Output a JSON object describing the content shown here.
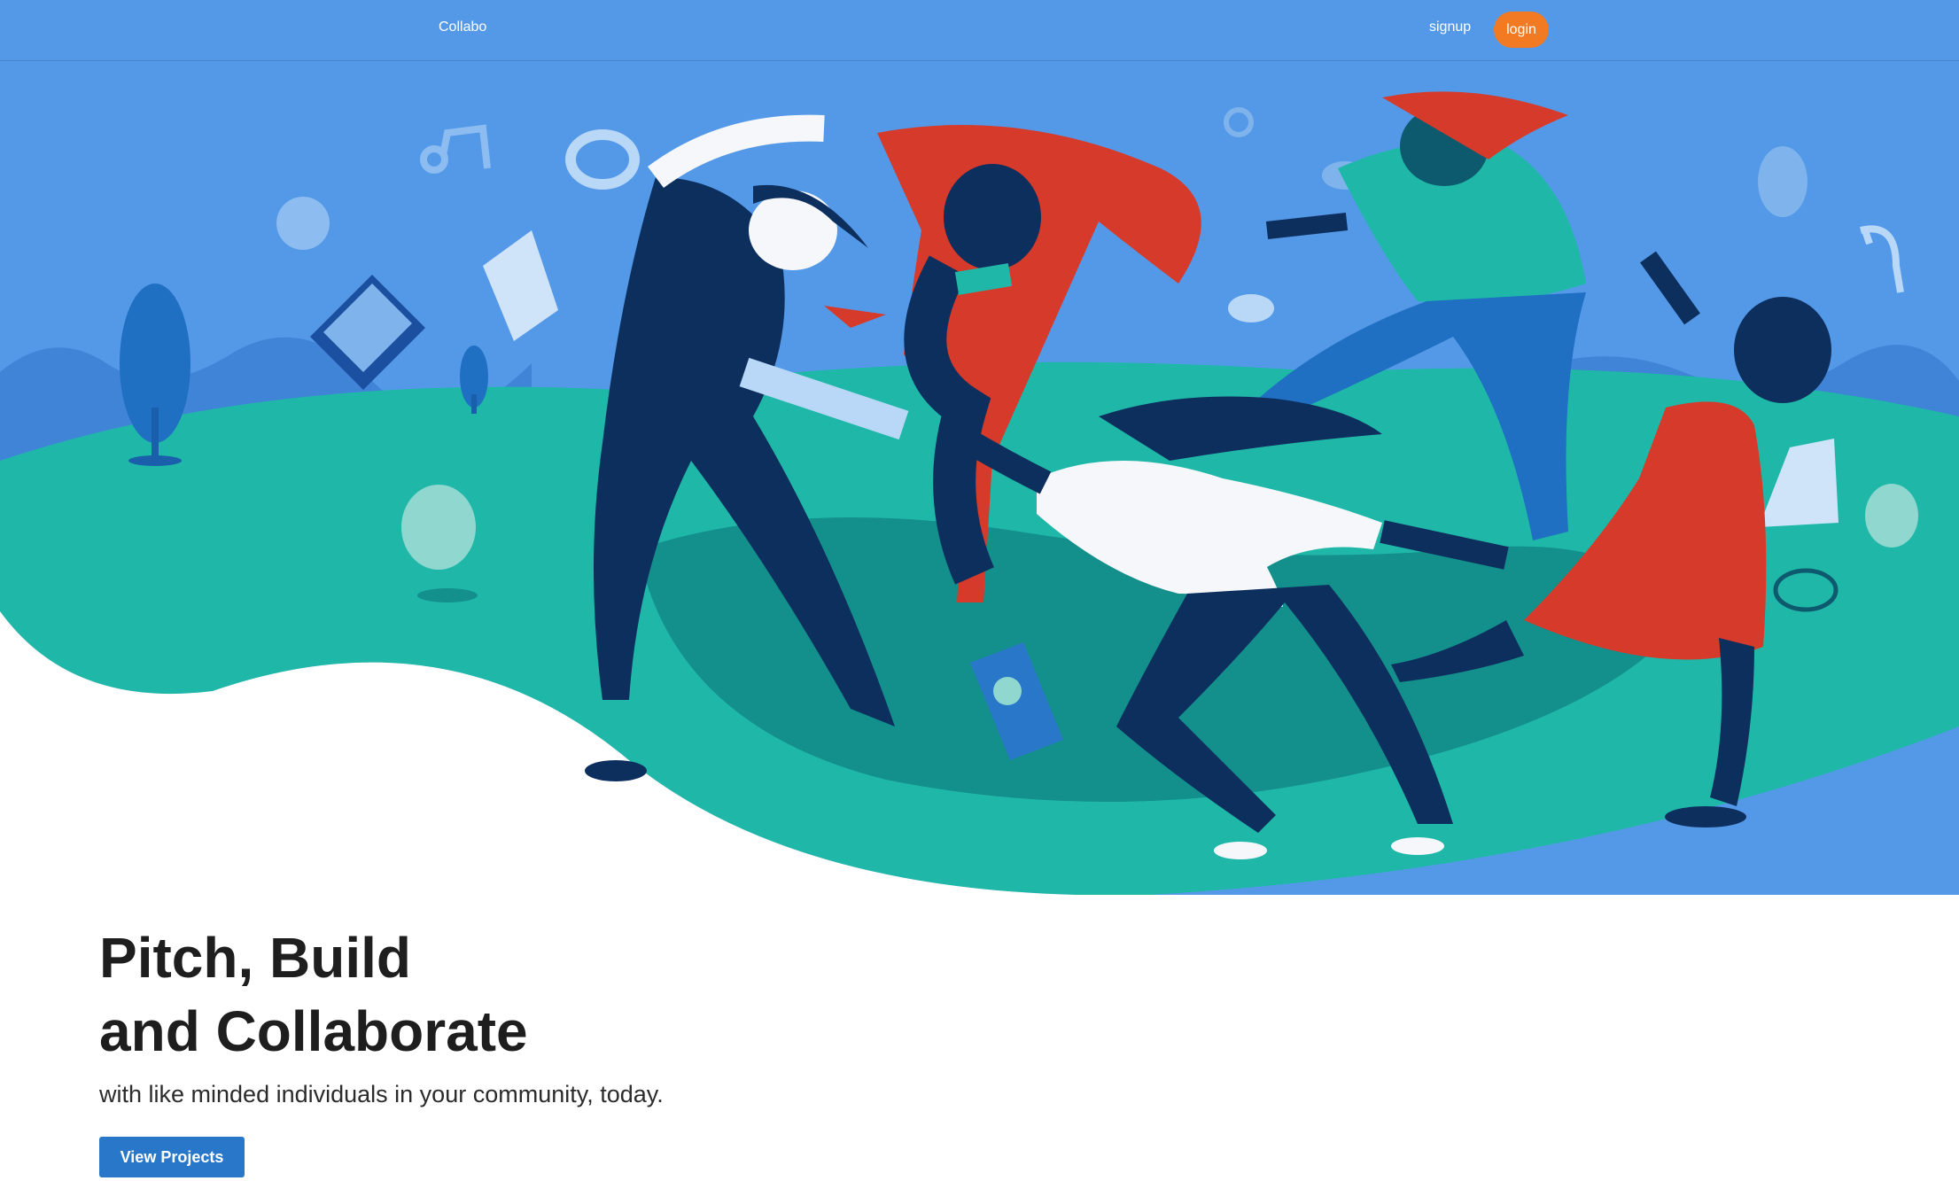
{
  "nav": {
    "brand": "Collabo",
    "signup_label": "signup",
    "login_label": "login"
  },
  "hero": {
    "illustration": "people-dancing-in-circle-illustration",
    "headline_line1": "Pitch, Build",
    "headline_line2": "and Collaborate",
    "subtext": "with like minded individuals in your community, today.",
    "cta_label": "View Projects"
  },
  "colors": {
    "nav_bg": "#5499e8",
    "sky": "#5499e8",
    "hills": "#1fb8a8",
    "accent_orange": "#f17a22",
    "cta_blue": "#2977c9",
    "figure_navy": "#0d2f5e",
    "figure_red": "#d63a2a"
  }
}
